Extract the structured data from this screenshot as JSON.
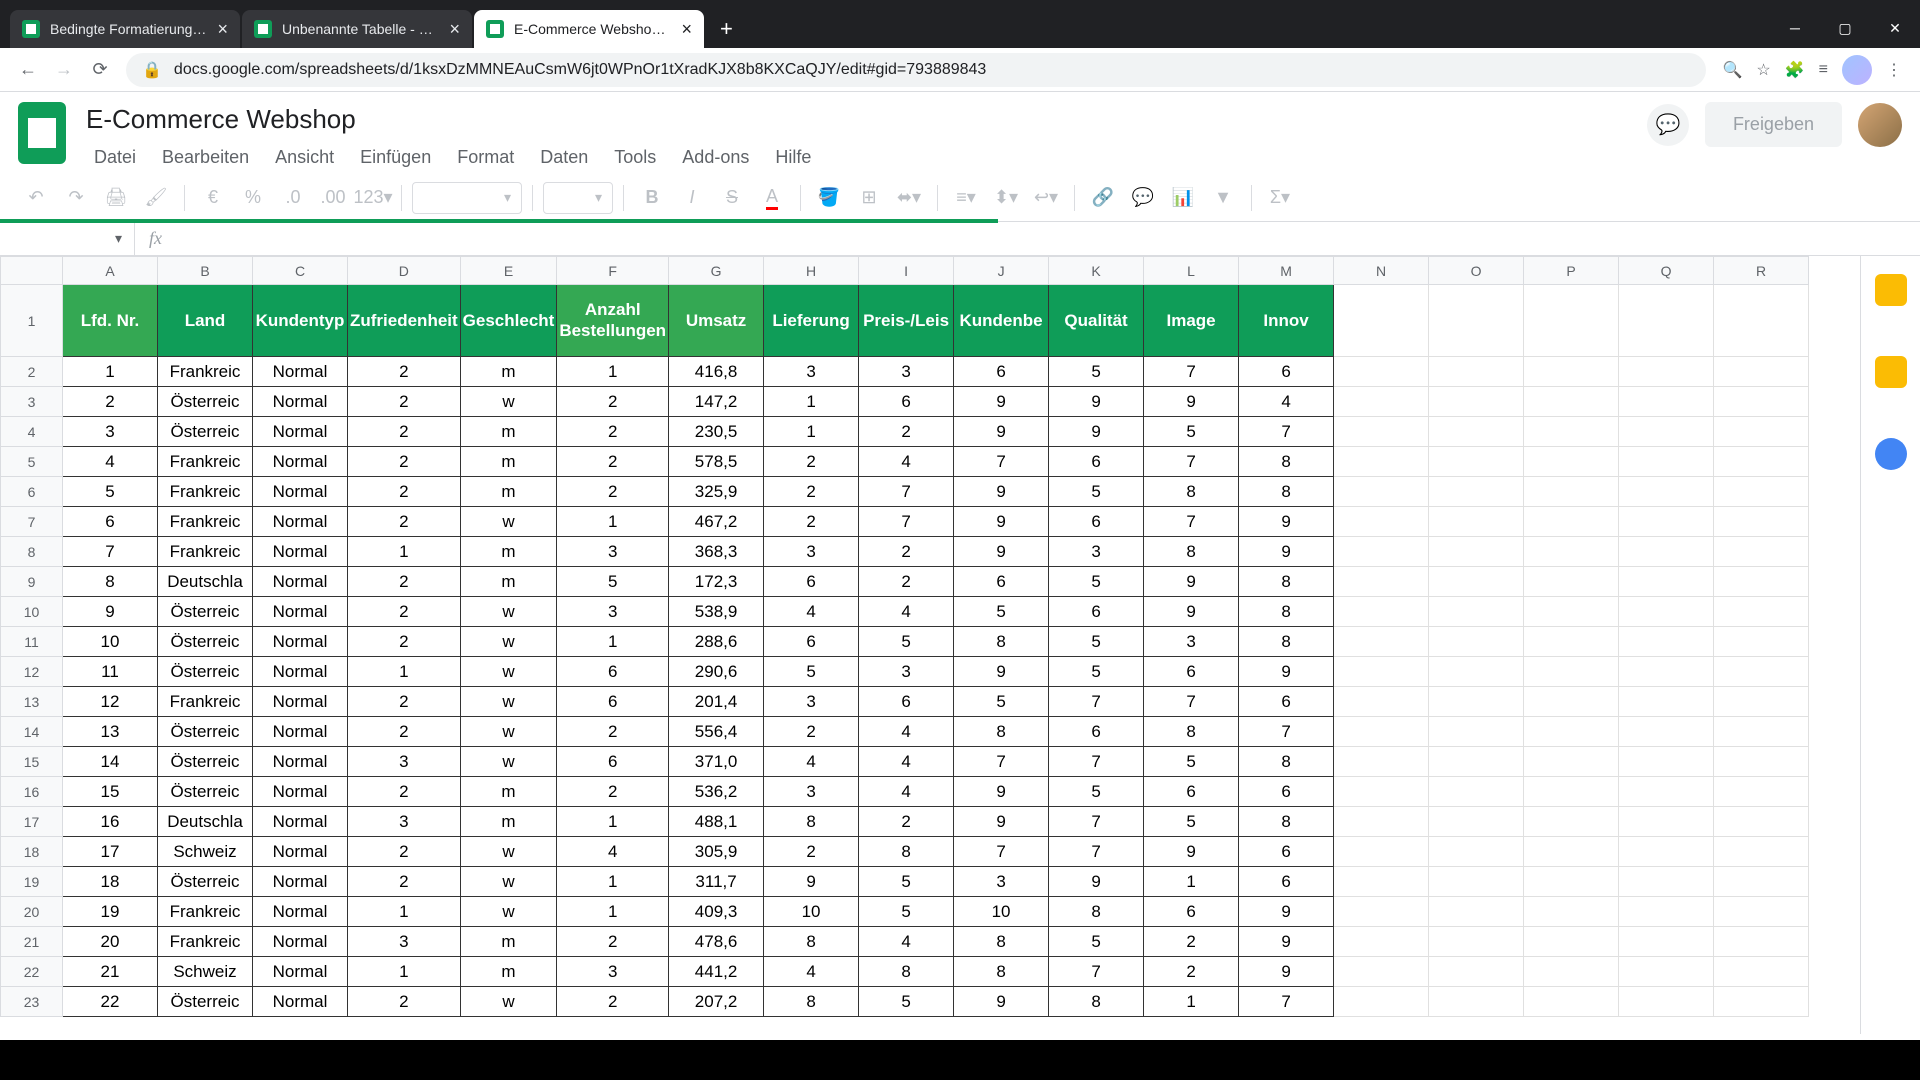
{
  "tabs": [
    {
      "title": "Bedingte Formatierung - Google",
      "active": false
    },
    {
      "title": "Unbenannte Tabelle - Google Ta",
      "active": false
    },
    {
      "title": "E-Commerce Webshop - Google",
      "active": true
    }
  ],
  "url": "docs.google.com/spreadsheets/d/1ksxDzMMNEAuCsmW6jt0WPnOr1tXradKJX8b8KXCaQJY/edit#gid=793889843",
  "doc_title": "E-Commerce Webshop",
  "menu": [
    "Datei",
    "Bearbeiten",
    "Ansicht",
    "Einfügen",
    "Format",
    "Daten",
    "Tools",
    "Add-ons",
    "Hilfe"
  ],
  "share_label": "Freigeben",
  "toolbar_labels": {
    "currency": "€",
    "percent": "%",
    "dec_dec": ".0",
    "inc_dec": ".00",
    "more_fmt": "123"
  },
  "columns": [
    "A",
    "B",
    "C",
    "D",
    "E",
    "F",
    "G",
    "H",
    "I",
    "J",
    "K",
    "L",
    "M",
    "N",
    "O",
    "P",
    "Q",
    "R"
  ],
  "headers": {
    "A": "Lfd. Nr.",
    "B": "Land",
    "C": "Kundentyp",
    "D": "Zufriedenheit",
    "E": "Geschlecht",
    "F": "Anzahl Bestellungen",
    "G": "Umsatz",
    "H": "Lieferung",
    "I": "Preis-/Leis",
    "J": "Kundenbe",
    "K": "Qualität",
    "L": "Image",
    "M": "Innov"
  },
  "chart_data": {
    "type": "table",
    "columns": [
      "Lfd. Nr.",
      "Land",
      "Kundentyp",
      "Zufriedenheit",
      "Geschlecht",
      "Anzahl Bestellungen",
      "Umsatz",
      "Lieferung",
      "Preis-/Leis",
      "Kundenbe",
      "Qualität",
      "Image",
      "Innov"
    ],
    "rows": [
      [
        1,
        "Frankreich",
        "Normal",
        2,
        "m",
        1,
        "416,8",
        3,
        3,
        6,
        5,
        7,
        6
      ],
      [
        2,
        "Österreich",
        "Normal",
        2,
        "w",
        2,
        "147,2",
        1,
        6,
        9,
        9,
        9,
        4
      ],
      [
        3,
        "Österreich",
        "Normal",
        2,
        "m",
        2,
        "230,5",
        1,
        2,
        9,
        9,
        5,
        7
      ],
      [
        4,
        "Frankreich",
        "Normal",
        2,
        "m",
        2,
        "578,5",
        2,
        4,
        7,
        6,
        7,
        8
      ],
      [
        5,
        "Frankreich",
        "Normal",
        2,
        "m",
        2,
        "325,9",
        2,
        7,
        9,
        5,
        8,
        8
      ],
      [
        6,
        "Frankreich",
        "Normal",
        2,
        "w",
        1,
        "467,2",
        2,
        7,
        9,
        6,
        7,
        9
      ],
      [
        7,
        "Frankreich",
        "Normal",
        1,
        "m",
        3,
        "368,3",
        3,
        2,
        9,
        3,
        8,
        9
      ],
      [
        8,
        "Deutschland",
        "Normal",
        2,
        "m",
        5,
        "172,3",
        6,
        2,
        6,
        5,
        9,
        8
      ],
      [
        9,
        "Österreich",
        "Normal",
        2,
        "w",
        3,
        "538,9",
        4,
        4,
        5,
        6,
        9,
        8
      ],
      [
        10,
        "Österreich",
        "Normal",
        2,
        "w",
        1,
        "288,6",
        6,
        5,
        8,
        5,
        3,
        8
      ],
      [
        11,
        "Österreich",
        "Normal",
        1,
        "w",
        6,
        "290,6",
        5,
        3,
        9,
        5,
        6,
        9
      ],
      [
        12,
        "Frankreich",
        "Normal",
        2,
        "w",
        6,
        "201,4",
        3,
        6,
        5,
        7,
        7,
        6
      ],
      [
        13,
        "Österreich",
        "Normal",
        2,
        "w",
        2,
        "556,4",
        2,
        4,
        8,
        6,
        8,
        7
      ],
      [
        14,
        "Österreich",
        "Normal",
        3,
        "w",
        6,
        "371,0",
        4,
        4,
        7,
        7,
        5,
        8
      ],
      [
        15,
        "Österreich",
        "Normal",
        2,
        "m",
        2,
        "536,2",
        3,
        4,
        9,
        5,
        6,
        6
      ],
      [
        16,
        "Deutschland",
        "Normal",
        3,
        "m",
        1,
        "488,1",
        8,
        2,
        9,
        7,
        5,
        8
      ],
      [
        17,
        "Schweiz",
        "Normal",
        2,
        "w",
        4,
        "305,9",
        2,
        8,
        7,
        7,
        9,
        6
      ],
      [
        18,
        "Österreich",
        "Normal",
        2,
        "w",
        1,
        "311,7",
        9,
        5,
        3,
        9,
        1,
        6
      ],
      [
        19,
        "Frankreich",
        "Normal",
        1,
        "w",
        1,
        "409,3",
        10,
        5,
        10,
        8,
        6,
        9
      ],
      [
        20,
        "Frankreich",
        "Normal",
        3,
        "m",
        2,
        "478,6",
        8,
        4,
        8,
        5,
        2,
        9
      ],
      [
        21,
        "Schweiz",
        "Normal",
        1,
        "m",
        3,
        "441,2",
        4,
        8,
        8,
        7,
        2,
        9
      ],
      [
        22,
        "Österreich",
        "Normal",
        2,
        "w",
        2,
        "207,2",
        8,
        5,
        9,
        8,
        1,
        7
      ]
    ]
  }
}
